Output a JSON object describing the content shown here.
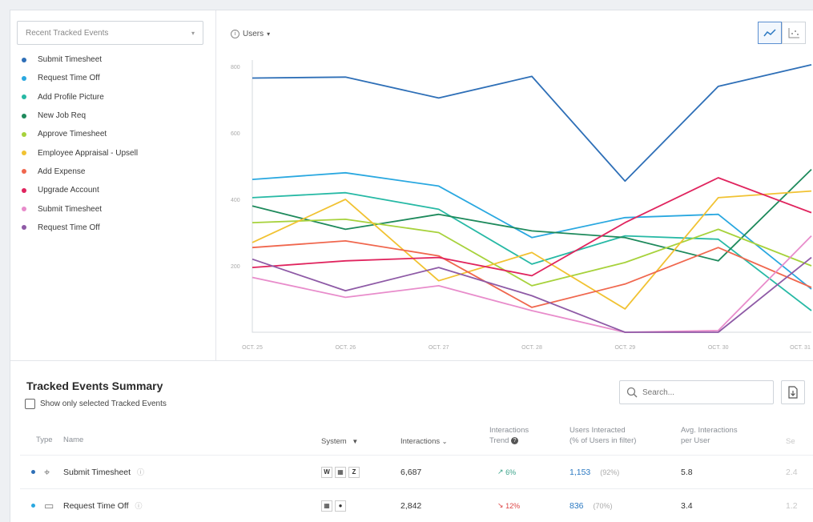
{
  "events_selector": {
    "placeholder": "Recent Tracked Events"
  },
  "legend": [
    {
      "label": "Submit Timesheet",
      "color": "#2e6fb7"
    },
    {
      "label": "Request Time Off",
      "color": "#2aa8e0"
    },
    {
      "label": "Add Profile Picture",
      "color": "#27b9a5"
    },
    {
      "label": "New Job Req",
      "color": "#1e8a5c"
    },
    {
      "label": "Approve Timesheet",
      "color": "#a7d23c"
    },
    {
      "label": "Employee Appraisal - Upsell",
      "color": "#f1c232"
    },
    {
      "label": "Add Expense",
      "color": "#f0674e"
    },
    {
      "label": "Upgrade Account",
      "color": "#e0245e"
    },
    {
      "label": "Submit Timesheet",
      "color": "#e88ccb"
    },
    {
      "label": "Request Time Off",
      "color": "#8e5aa6"
    }
  ],
  "metric": {
    "label": "Users"
  },
  "chart_data": {
    "type": "line",
    "x": [
      "OCT. 25",
      "OCT. 26",
      "OCT. 27",
      "OCT. 28",
      "OCT. 29",
      "OCT. 30",
      "OCT. 31"
    ],
    "y_ticks": [
      "800",
      "600",
      "400",
      "200"
    ],
    "ylim": [
      0,
      800
    ],
    "grid": false,
    "series": [
      {
        "name": "Submit Timesheet",
        "color": "#2e6fb7",
        "values": [
          765,
          768,
          705,
          770,
          455,
          740,
          805
        ]
      },
      {
        "name": "Request Time Off",
        "color": "#2aa8e0",
        "values": [
          460,
          480,
          440,
          285,
          345,
          355,
          130
        ]
      },
      {
        "name": "Add Profile Picture",
        "color": "#27b9a5",
        "values": [
          405,
          420,
          370,
          205,
          290,
          280,
          65
        ]
      },
      {
        "name": "New Job Req",
        "color": "#1e8a5c",
        "values": [
          380,
          310,
          355,
          305,
          285,
          215,
          490
        ]
      },
      {
        "name": "Approve Timesheet",
        "color": "#a7d23c",
        "values": [
          330,
          340,
          300,
          140,
          210,
          310,
          200
        ]
      },
      {
        "name": "Employee Appraisal - Upsell",
        "color": "#f1c232",
        "values": [
          270,
          400,
          155,
          240,
          70,
          405,
          425
        ]
      },
      {
        "name": "Add Expense",
        "color": "#f0674e",
        "values": [
          255,
          275,
          230,
          75,
          145,
          255,
          135
        ]
      },
      {
        "name": "Upgrade Account",
        "color": "#e0245e",
        "values": [
          195,
          215,
          225,
          170,
          330,
          465,
          360
        ]
      },
      {
        "name": "Submit Timesheet",
        "color": "#e88ccb",
        "values": [
          165,
          105,
          140,
          65,
          0,
          5,
          290
        ]
      },
      {
        "name": "Request Time Off",
        "color": "#8e5aa6",
        "values": [
          220,
          125,
          195,
          110,
          0,
          0,
          225
        ]
      }
    ]
  },
  "summary": {
    "title": "Tracked Events Summary",
    "filter_label": "Show only selected Tracked Events",
    "search_placeholder": "Search...",
    "columns": {
      "type": "Type",
      "name": "Name",
      "system": "System",
      "interactions": "Interactions",
      "trend_1": "Interactions",
      "trend_2": "Trend",
      "users_1": "Users Interacted",
      "users_2": "(% of Users in filter)",
      "avg_1": "Avg. Interactions",
      "avg_2": "per User",
      "extra": "Se"
    },
    "rows": [
      {
        "name": "Submit Timesheet",
        "dot_color": "#2e6fb7",
        "interactions": "6,687",
        "trend": "6%",
        "trend_dir": "up",
        "users": "1,153",
        "users_pct": "(92%)",
        "avg": "5.8",
        "extra": "2.4",
        "systems": [
          "W",
          "▦",
          "Z"
        ]
      },
      {
        "name": "Request Time Off",
        "dot_color": "#2aa8e0",
        "interactions": "2,842",
        "trend": "12%",
        "trend_dir": "down",
        "users": "836",
        "users_pct": "(70%)",
        "avg": "3.4",
        "extra": "1.2",
        "systems": [
          "▦",
          "●"
        ]
      }
    ]
  }
}
